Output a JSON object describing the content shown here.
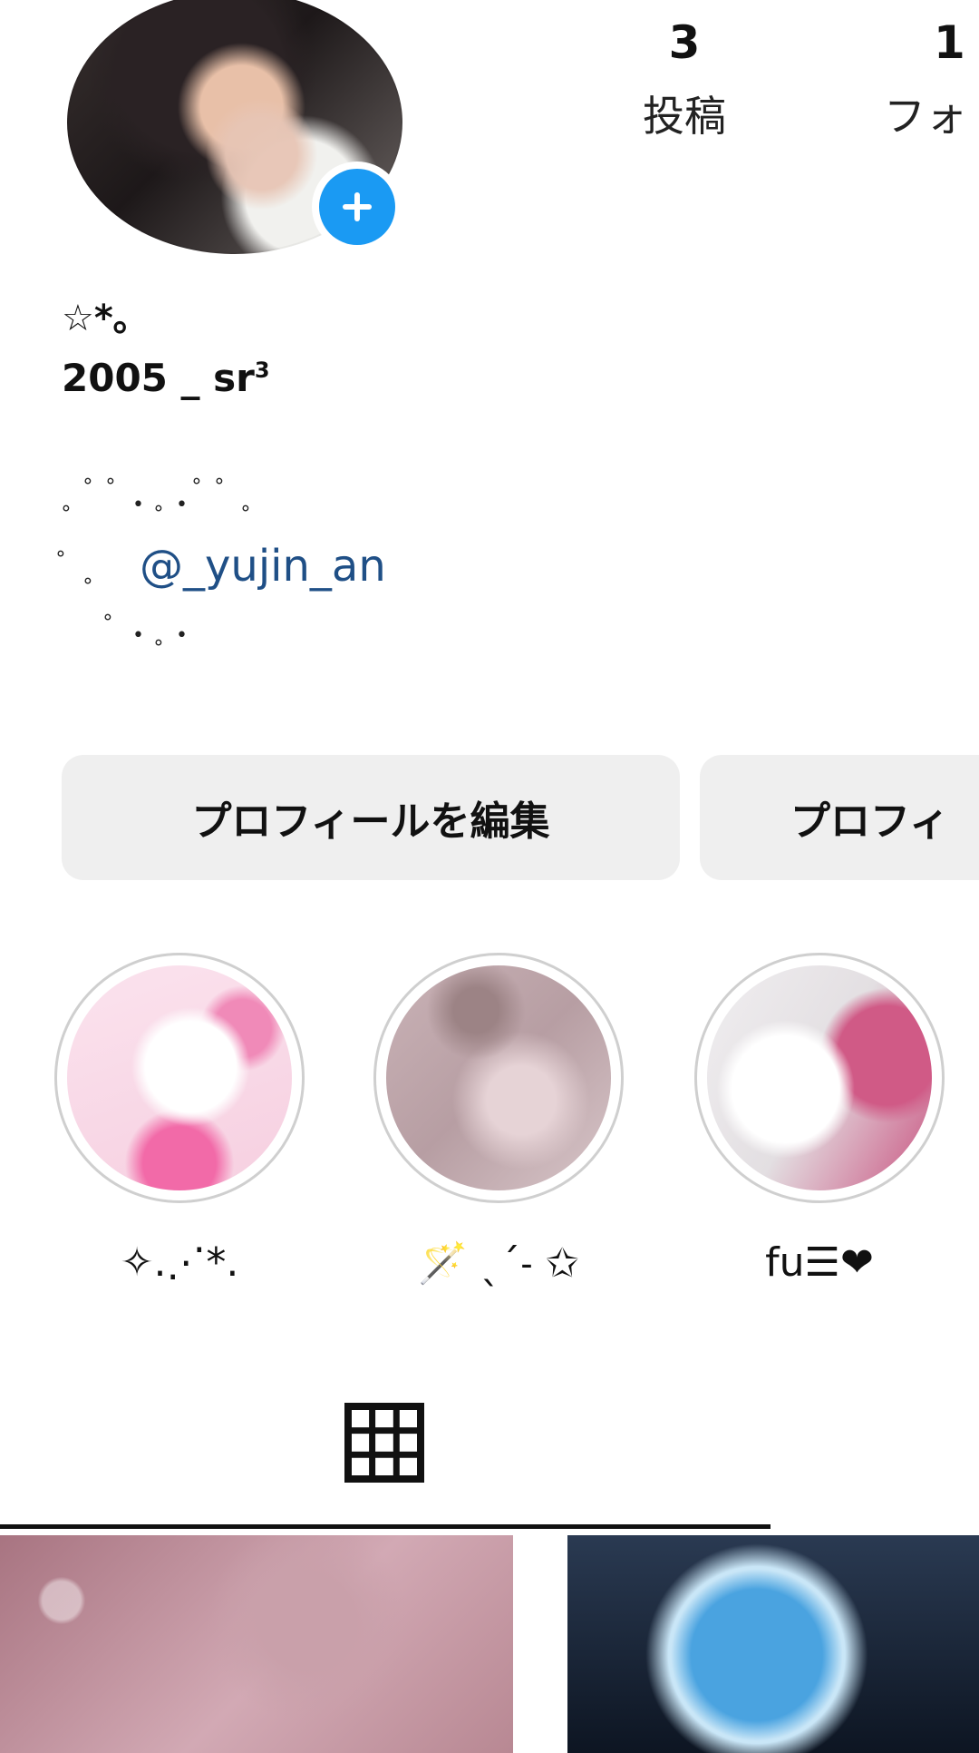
{
  "profile": {
    "display_name": "☆*｡",
    "bio_line1": "2005 _ sr",
    "bio_line1_sup": "3",
    "bio_mention": "@_yujin_an"
  },
  "stats": {
    "posts_count": "3",
    "posts_label": "投稿",
    "followers_count": "1",
    "followers_label": "フォ"
  },
  "buttons": {
    "edit_profile": "プロフィールを編集",
    "share_profile": "プロフィ"
  },
  "highlights": [
    {
      "label": "✧.⋰*."
    },
    {
      "label": "🪄 ˎˊ˗ ✩"
    },
    {
      "label": "fu☰❤"
    }
  ],
  "tabs": {
    "active": "grid"
  },
  "colors": {
    "accent": "#1a9af3",
    "mention": "#1f4f86",
    "button_bg": "#efefef"
  },
  "icons": {
    "add_story": "plus-circle-icon",
    "grid_tab": "grid-icon"
  }
}
